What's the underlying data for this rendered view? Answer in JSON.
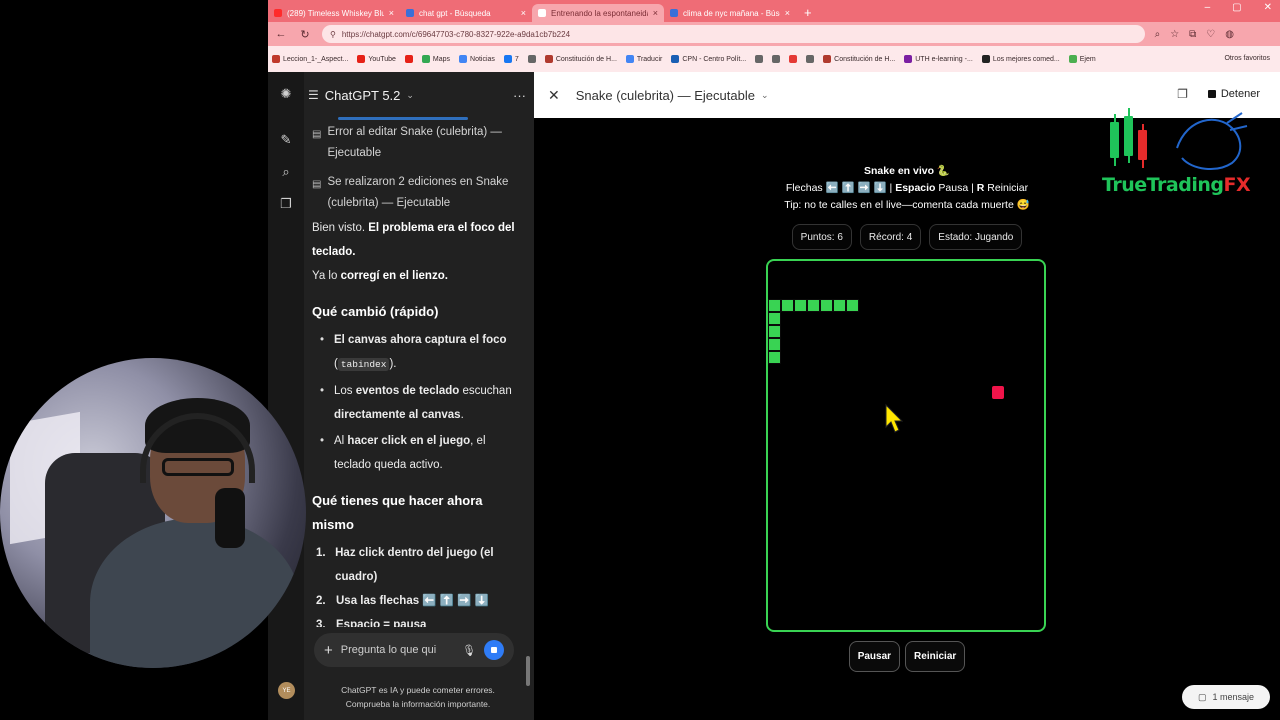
{
  "browser": {
    "tabs": [
      {
        "label": "(289) Timeless Whiskey Blues",
        "icon": "youtube-icon",
        "active": false
      },
      {
        "label": "chat gpt - Búsqueda",
        "icon": "search-icon",
        "active": false
      },
      {
        "label": "Entrenando la espontaneidad",
        "icon": "chatgpt-icon",
        "active": true
      },
      {
        "label": "clima de nyc mañana - Búsqueda",
        "icon": "search-icon",
        "active": false
      }
    ],
    "new_tab": "+",
    "url": "https://chatgpt.com/c/69647703-c780-8327-922e-a9da1cb7b224",
    "bookmarks": [
      {
        "label": "Leccion_1-_Aspect...",
        "color": "#c0392b"
      },
      {
        "label": "YouTube",
        "color": "#e62117"
      },
      {
        "label": "",
        "color": "#e62117"
      },
      {
        "label": "Maps",
        "color": "#34a853"
      },
      {
        "label": "Noticias",
        "color": "#4285f4"
      },
      {
        "label": "7",
        "color": "#1877f2"
      },
      {
        "label": "",
        "color": "#666666"
      },
      {
        "label": "Constitución de H...",
        "color": "#b03a2e"
      },
      {
        "label": "Traducir",
        "color": "#4285f4"
      },
      {
        "label": "CPN - Centro Polít...",
        "color": "#1a5fb4"
      },
      {
        "label": "",
        "color": "#666666"
      },
      {
        "label": "",
        "color": "#666666"
      },
      {
        "label": "",
        "color": "#e53935"
      },
      {
        "label": "",
        "color": "#666666"
      },
      {
        "label": "Constitución de H...",
        "color": "#b03a2e"
      },
      {
        "label": "UTH e-learning -...",
        "color": "#7b1fa2"
      },
      {
        "label": "Los mejores comed...",
        "color": "#222222"
      },
      {
        "label": "Ejem",
        "color": "#4caf50"
      }
    ],
    "other_bookmarks": "Otros favoritos"
  },
  "chat": {
    "model_title": "ChatGPT 5.2",
    "edit_notes": [
      "Error al editar Snake (culebrita) — Ejecutable",
      "Se realizaron 2 ediciones en Snake (culebrita) — Ejecutable"
    ],
    "reply_line1_plain": "Bien visto. ",
    "reply_line1_bold": "El problema era el foco del teclado.",
    "reply_line2_plain": "Ya lo ",
    "reply_line2_bold": "corregí en el lienzo.",
    "section1_title": "Qué cambió (rápido)",
    "bullets": [
      {
        "pre": "",
        "bold": "El canvas ahora captura el foco",
        "code": "tabindex",
        "post": ""
      },
      {
        "pre": "Los ",
        "bold": "eventos de teclado",
        "post": " escuchan ",
        "bold2": "directamente al canvas",
        "end": "."
      },
      {
        "pre": "Al ",
        "bold": "hacer click en el juego",
        "post": ", el teclado queda activo."
      }
    ],
    "section2_title": "Qué tienes que hacer ahora mismo",
    "steps": [
      {
        "n": "1.",
        "text": "Haz click dentro del juego (el cuadro)"
      },
      {
        "n": "2.",
        "text": "Usa las flechas ⬅️ ⬆️ ➡️ ⬇️"
      },
      {
        "n": "3.",
        "text": "Espacio = pausa"
      }
    ],
    "composer_placeholder": "Pregunta lo que qui",
    "disclaimer_line1": "ChatGPT es IA y puede cometer errores.",
    "disclaimer_line2": "Comprueba la información importante.",
    "avatar_initials": "YE"
  },
  "canvas": {
    "title": "Snake (culebrita) — Ejecutable",
    "stop_label": "Detener",
    "logo_text_main": "TrueTrading",
    "logo_text_fx": "FX",
    "game_title": "Snake en vivo 🐍",
    "instructions_pre": "Flechas ⬅️ ⬆️ ➡️ ⬇️ | ",
    "instructions_space": "Espacio",
    "instructions_mid": " Pausa | ",
    "instructions_r": "R",
    "instructions_post": " Reiniciar",
    "tip": "Tip: no te calles en el live—comenta cada muerte 😅",
    "score_label": "Puntos: 6",
    "record_label": "Récord: 4",
    "state_label": "Estado: Jugando",
    "pause_button": "Pausar",
    "restart_button": "Reiniciar",
    "snake_color": "#39d353",
    "food_color": "#f0144a",
    "message_badge": "1 mensaje"
  }
}
